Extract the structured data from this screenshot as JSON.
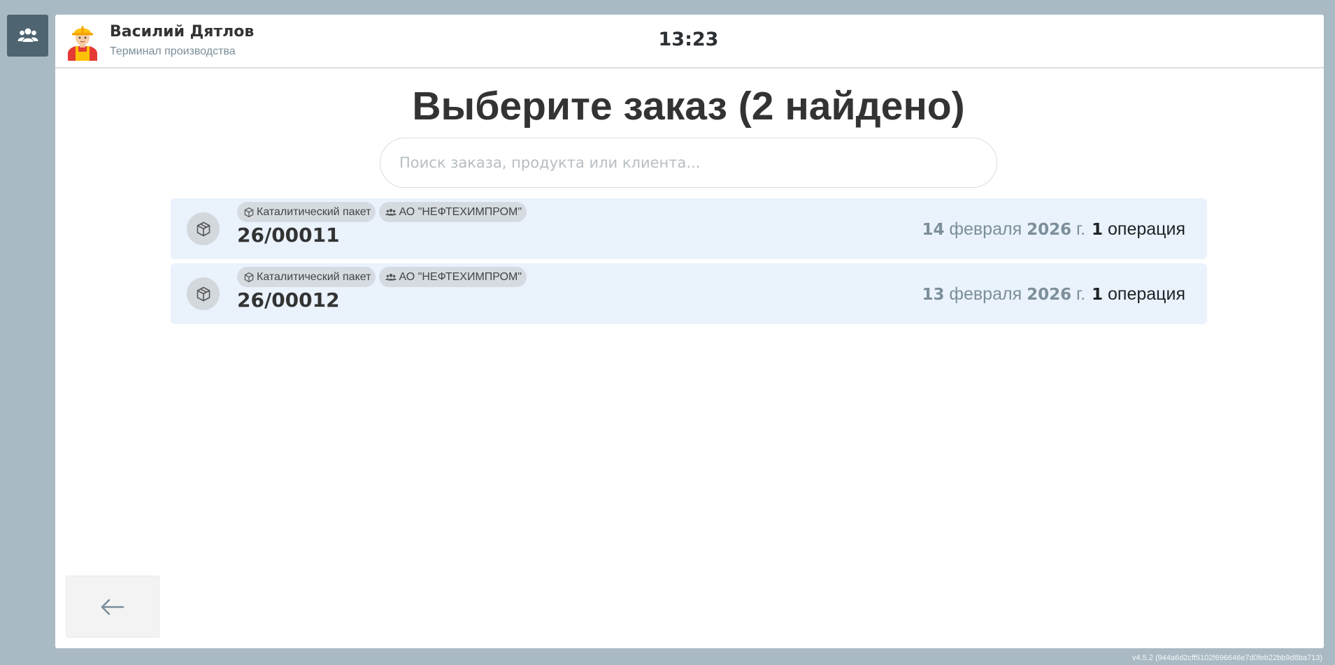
{
  "sidebar": {
    "users_icon": "users-icon"
  },
  "header": {
    "user_name": "Василий Дятлов",
    "user_role": "Терминал производства",
    "clock": "13:23",
    "avatar_icon": "worker-avatar"
  },
  "main": {
    "title": "Выберите заказ (2 найдено)",
    "search": {
      "placeholder": "Поиск заказа, продукта или клиента...",
      "value": ""
    }
  },
  "orders": [
    {
      "product": "Каталитический пакет",
      "client": "АО \"НЕФТЕХИМПРОМ\"",
      "number": "26/00011",
      "date_day": "14",
      "date_month": "февраля",
      "date_year": "2026",
      "date_suffix": "г.",
      "ops_count": "1",
      "ops_label": "операция"
    },
    {
      "product": "Каталитический пакет",
      "client": "АО \"НЕФТЕХИМПРОМ\"",
      "number": "26/00012",
      "date_day": "13",
      "date_month": "февраля",
      "date_year": "2026",
      "date_suffix": "г.",
      "ops_count": "1",
      "ops_label": "операция"
    }
  ],
  "footer": {
    "back_icon": "arrow-left-icon",
    "version": "v4.5.2 (944a6d2cff5102f696646e7d0feb22bb9d8ba713)"
  },
  "colors": {
    "background": "#a9bac4",
    "rail_button": "#4e6470",
    "order_row": "#eaf2fc",
    "date_text": "#7c8f9a"
  }
}
